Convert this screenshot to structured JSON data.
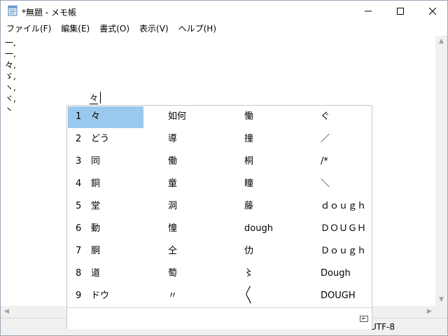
{
  "window": {
    "title": "*無題 - メモ帳",
    "minimize_glyph": "—",
    "maximize_glyph": "☐",
    "close_glyph": "✕",
    "app_icon": "notepad-icon"
  },
  "menu": {
    "items": [
      "ファイル(F)",
      "編集(E)",
      "書式(O)",
      "表示(V)",
      "ヘルプ(H)"
    ]
  },
  "editor": {
    "lines": [
      "一,",
      "一,",
      "々,",
      "ゞ,",
      "ヽ,",
      "ヾ,",
      "丶"
    ],
    "composition": "々"
  },
  "candidates": {
    "numbers": [
      "1",
      "2",
      "3",
      "4",
      "5",
      "6",
      "7",
      "8",
      "9"
    ],
    "selected_index": 0,
    "columns": [
      [
        "々",
        "どう",
        "同",
        "銅",
        "堂",
        "動",
        "胴",
        "道",
        "ドウ"
      ],
      [
        "如何",
        "導",
        "働",
        "童",
        "洞",
        "憧",
        "仝",
        "萄",
        "〃"
      ],
      [
        "慟",
        "撞",
        "桐",
        "瞳",
        "藤",
        "dough",
        "仂",
        "〻",
        "〱"
      ],
      [
        "ぐ",
        "／",
        "/*",
        "＼",
        "ｄｏｕｇｈ",
        "ＤＯＵＧＨ",
        "Ｄｏｕｇｈ",
        "Dough",
        "DOUGH"
      ]
    ],
    "footer_icon": "expand-table-icon"
  },
  "status": {
    "encoding": "UTF-8"
  }
}
